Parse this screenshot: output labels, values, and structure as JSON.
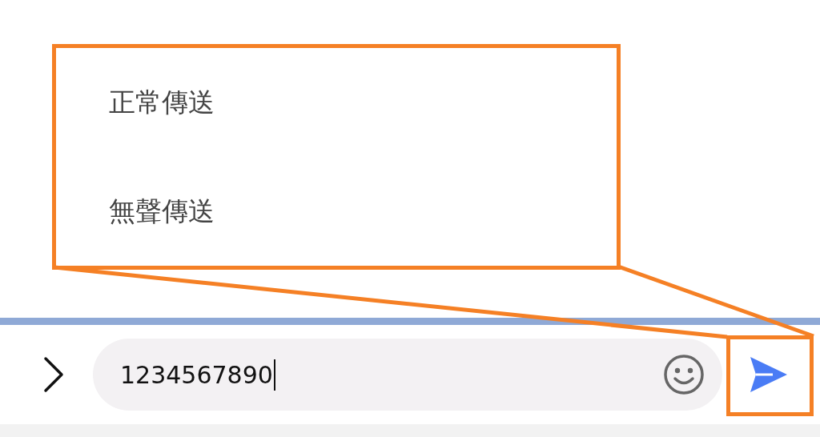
{
  "popup_menu": {
    "items": [
      {
        "label": "正常傳送"
      },
      {
        "label": "無聲傳送"
      }
    ]
  },
  "composer": {
    "message": "1234567890"
  }
}
